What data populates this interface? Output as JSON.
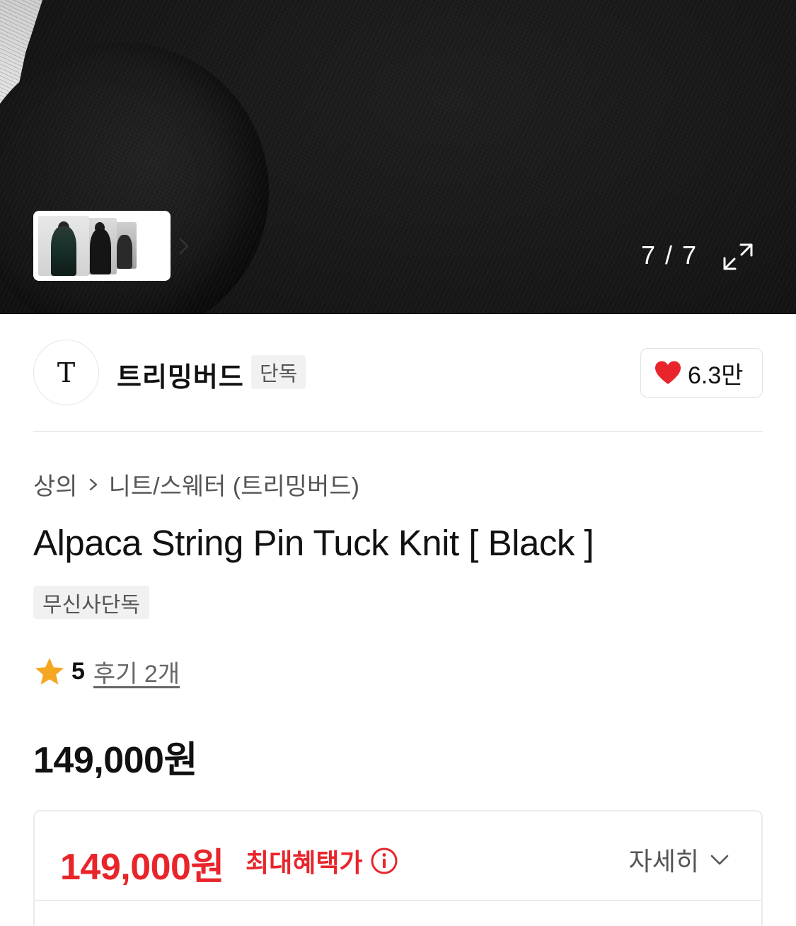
{
  "gallery": {
    "counter": "7 / 7",
    "thumbnail_count": 3,
    "thumbnail_icon": "chevron-right-icon",
    "expand_icon": "expand-arrows-icon"
  },
  "brand": {
    "logo_text": "T",
    "name": "트리밍버드",
    "tag": "단독",
    "likes": "6.3만",
    "like_icon": "heart-icon",
    "like_color": "#e8252b"
  },
  "breadcrumb": {
    "category": "상의",
    "subcategory": "니트/스웨터 (트리밍버드)"
  },
  "product": {
    "title": "Alpaca String Pin Tuck Knit [ Black ]",
    "exclusive_tag": "무신사단독",
    "rating": "5",
    "reviews": "후기 2개",
    "price": "149,000원"
  },
  "benefit": {
    "price": "149,000원",
    "label": "최대혜택가",
    "detail_label": "자세히",
    "accent_color": "#e8252b"
  }
}
